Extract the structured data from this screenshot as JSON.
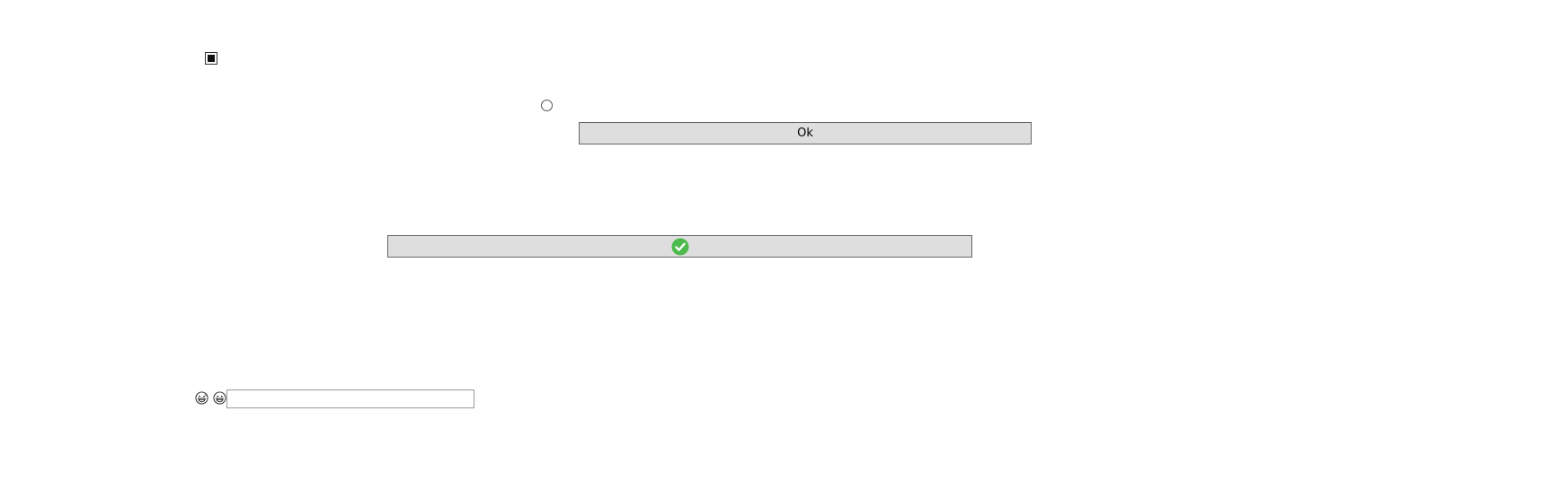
{
  "checkbox": {
    "checked": true
  },
  "radio": {
    "checked": false
  },
  "ok_button": {
    "label": "Ok"
  },
  "check_button": {
    "icon": "check-circle-icon",
    "icon_color": "#4cba4c"
  },
  "emojis": [
    {
      "icon": "grinning-sweat-face-icon"
    },
    {
      "icon": "grinning-face-icon"
    }
  ],
  "text_input": {
    "value": "",
    "placeholder": ""
  }
}
